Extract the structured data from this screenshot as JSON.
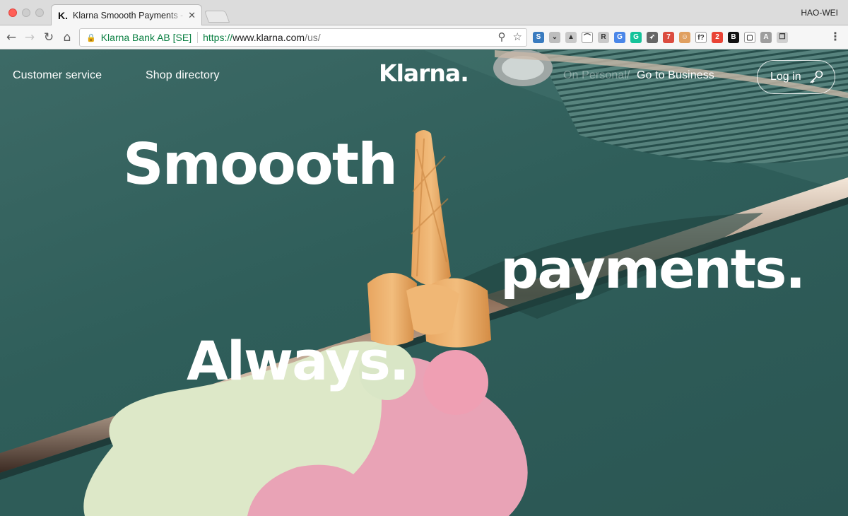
{
  "browser": {
    "tab": {
      "favicon": "K.",
      "title": "Klarna Smoooth Payments - M",
      "close": "✕"
    },
    "profile_name": "HAO-WEI",
    "nav": {
      "back": "←",
      "forward": "→",
      "reload": "↻",
      "home": "⌂"
    },
    "omnibox": {
      "lock_icon": "lock-icon",
      "site_identity": "Klarna Bank AB [SE]",
      "url_scheme": "https://",
      "url_host": "www.klarna.com",
      "url_path": "/us/"
    },
    "extensions": [
      {
        "name": "s-extension-icon",
        "glyph": "S",
        "color": "#3a7bbf"
      },
      {
        "name": "pocket-icon",
        "glyph": "⌄",
        "color": "#bdbdbd"
      },
      {
        "name": "drive-icon",
        "glyph": "▲",
        "color": "#c9c9c9"
      },
      {
        "name": "rainbow-icon",
        "glyph": "⌒",
        "color": "#ffffff"
      },
      {
        "name": "r-extension-icon",
        "glyph": "R",
        "color": "#c9c9c9"
      },
      {
        "name": "translate-icon",
        "glyph": "G",
        "color": "#4a86e8"
      },
      {
        "name": "grammarly-icon",
        "glyph": "G",
        "color": "#15c39a"
      },
      {
        "name": "rocket-icon",
        "glyph": "➶",
        "color": "#666666"
      },
      {
        "name": "todoist-icon",
        "glyph": "7",
        "color": "#db4c3f"
      },
      {
        "name": "face-icon",
        "glyph": "☺",
        "color": "#e0a060"
      },
      {
        "name": "font-icon",
        "glyph": "f?",
        "color": "#ffffff"
      },
      {
        "name": "badge-icon",
        "glyph": "2",
        "color": "#e94335"
      },
      {
        "name": "b-extension-icon",
        "glyph": "B",
        "color": "#111111"
      },
      {
        "name": "window-icon",
        "glyph": "▢",
        "color": "#ffffff"
      },
      {
        "name": "a-extension-icon",
        "glyph": "A",
        "color": "#9e9e9e"
      },
      {
        "name": "copy-icon",
        "glyph": "❐",
        "color": "#d0d0d0"
      }
    ]
  },
  "site": {
    "nav": {
      "customer_service": "Customer service",
      "shop_directory": "Shop directory",
      "logo": "Klarna.",
      "on_personal": "On Personal",
      "slash": "/",
      "go_to_business": "Go to Business",
      "log_in": "Log in"
    },
    "hero": {
      "line1": "Smoooth",
      "line2": "payments.",
      "line3": "Always."
    }
  }
}
